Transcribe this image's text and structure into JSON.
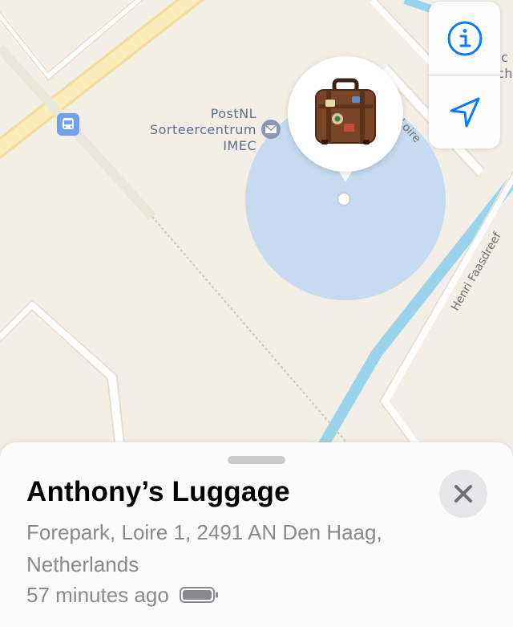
{
  "map": {
    "poi": {
      "name_lines": [
        "PostNL",
        "Sorteercentrum",
        "IMEC"
      ],
      "icon": "mail-icon"
    },
    "roads": {
      "loire": "Loire",
      "henri": "Henri Faasdreef"
    },
    "edge_label_fragment": [
      "ic",
      "ch"
    ],
    "transit_icon": "train-station-icon",
    "accuracy_color": "#c6dbf0",
    "water_color": "#9ad4ea",
    "land_color": "#f3efe7"
  },
  "controls": {
    "info_icon": "info-icon",
    "location_icon": "location-arrow-icon",
    "accent": "#0a7aff"
  },
  "pin": {
    "icon": "luggage-icon"
  },
  "item": {
    "title": "Anthony’s Luggage",
    "address": "Forepark, Loire 1, 2491 AN Den Haag, Netherlands",
    "time_ago": "57 minutes ago",
    "battery_icon": "battery-icon",
    "close_icon": "close-icon"
  }
}
